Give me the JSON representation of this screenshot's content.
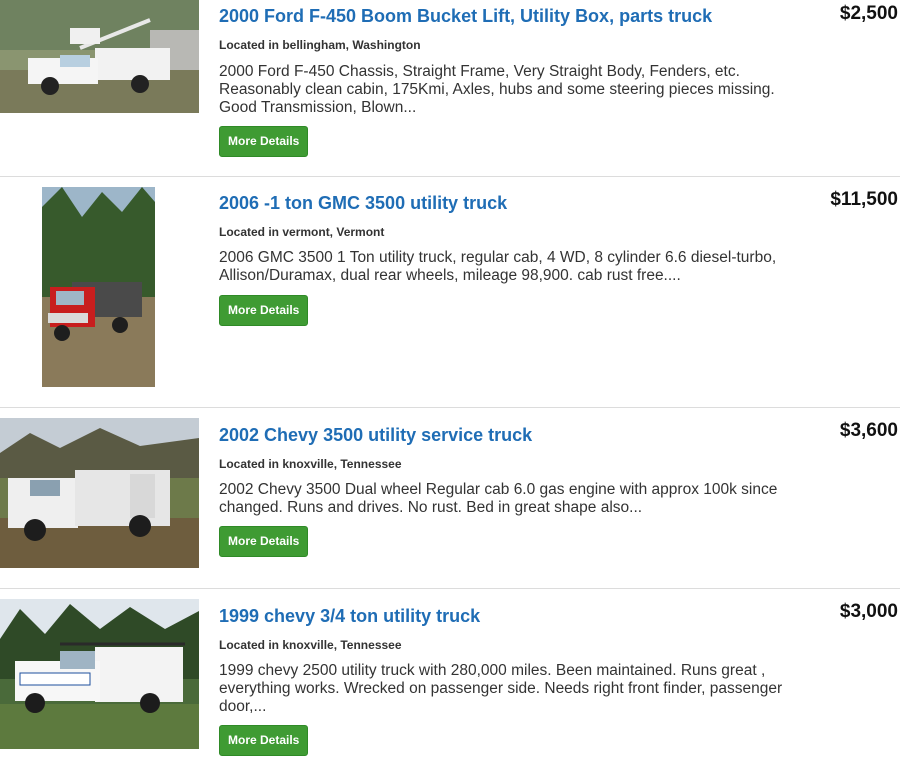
{
  "listings": [
    {
      "title": "2000 Ford F-450 Boom Bucket Lift, Utility Box, parts truck",
      "location": "Located in bellingham, Washington",
      "description": "2000 Ford F-450 Chassis, Straight Frame, Very Straight Body, Fenders, etc. Reasonably clean cabin, 175Kmi, Axles, hubs and some steering pieces missing. Good Transmission, Blown...",
      "price": "$2,500",
      "button_label": "More Details"
    },
    {
      "title": "2006 -1 ton GMC 3500 utility truck",
      "location": "Located in vermont, Vermont",
      "description": "2006 GMC 3500 1 Ton utility truck, regular cab, 4 WD, 8 cylinder 6.6 diesel-turbo, Allison/Duramax, dual rear wheels, mileage 98,900. cab rust free....",
      "price": "$11,500",
      "button_label": "More Details"
    },
    {
      "title": "2002 Chevy 3500 utility service truck",
      "location": "Located in knoxville, Tennessee",
      "description": "2002 Chevy 3500 Dual wheel Regular cab 6.0 gas engine with approx 100k since changed. Runs and drives. No rust. Bed in great shape also...",
      "price": "$3,600",
      "button_label": "More Details"
    },
    {
      "title": "1999 chevy 3/4 ton utility truck",
      "location": "Located in knoxville, Tennessee",
      "description": "1999 chevy 2500 utility truck with 280,000 miles. Been maintained. Runs great , everything works. Wrecked on passenger side. Needs right front finder, passenger door,...",
      "price": "$3,000",
      "button_label": "More Details"
    }
  ],
  "colors": {
    "title_link": "#1f6db5",
    "button_bg": "#3f9b33",
    "divider": "#dcdcdc"
  }
}
